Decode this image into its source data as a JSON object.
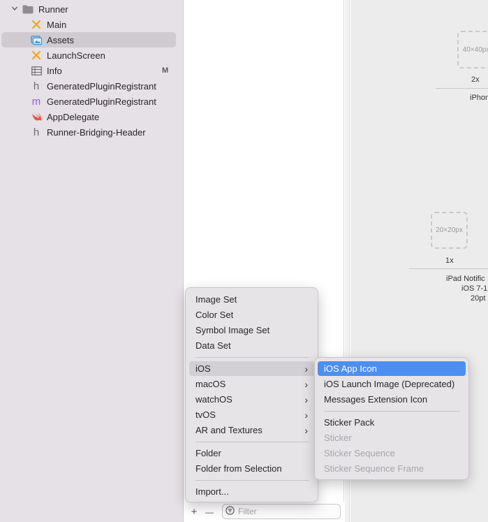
{
  "navigator": {
    "items": [
      {
        "label": "Runner",
        "icon": "folder-icon",
        "badge": ""
      },
      {
        "label": "Main",
        "icon": "interface-builder-icon",
        "badge": ""
      },
      {
        "label": "Assets",
        "icon": "asset-catalog-icon",
        "badge": ""
      },
      {
        "label": "LaunchScreen",
        "icon": "interface-builder-icon",
        "badge": ""
      },
      {
        "label": "Info",
        "icon": "property-list-icon",
        "badge": "M"
      },
      {
        "label": "GeneratedPluginRegistrant",
        "icon": "header-file-icon",
        "badge": ""
      },
      {
        "label": "GeneratedPluginRegistrant",
        "icon": "objc-file-icon",
        "badge": ""
      },
      {
        "label": "AppDelegate",
        "icon": "swift-file-icon",
        "badge": ""
      },
      {
        "label": "Runner-Bridging-Header",
        "icon": "header-file-icon",
        "badge": ""
      }
    ]
  },
  "icons": {
    "h_glyph": "h",
    "m_glyph": "m"
  },
  "bottom_bar": {
    "add": "+",
    "remove": "—",
    "filter_placeholder": "Filter"
  },
  "editor": {
    "slot1_size": "40×40px",
    "slot1_scale": "2x",
    "slot1_caption": "iPhon",
    "slot2_size": "20×20px",
    "slot2_scale": "1x",
    "slot2_caption_line1": "iPad Notific",
    "slot2_caption_line2": "iOS 7-1",
    "slot2_caption_line3": "20pt"
  },
  "add_menu": {
    "items": [
      "Image Set",
      "Color Set",
      "Symbol Image Set",
      "Data Set",
      "iOS",
      "macOS",
      "watchOS",
      "tvOS",
      "AR and Textures",
      "Folder",
      "Folder from Selection",
      "Import..."
    ],
    "chevron": "›"
  },
  "ios_submenu": {
    "items": [
      "iOS App Icon",
      "iOS Launch Image (Deprecated)",
      "Messages Extension Icon",
      "Sticker Pack",
      "Sticker",
      "Sticker Sequence",
      "Sticker Sequence Frame"
    ]
  },
  "colors": {
    "accent": "#4c8ff0",
    "sidebar": "#e5e1e6",
    "menu": "#e7e4e8",
    "xib": "#f0a61e",
    "swift": "#f05138",
    "objc": "#a454d9"
  }
}
